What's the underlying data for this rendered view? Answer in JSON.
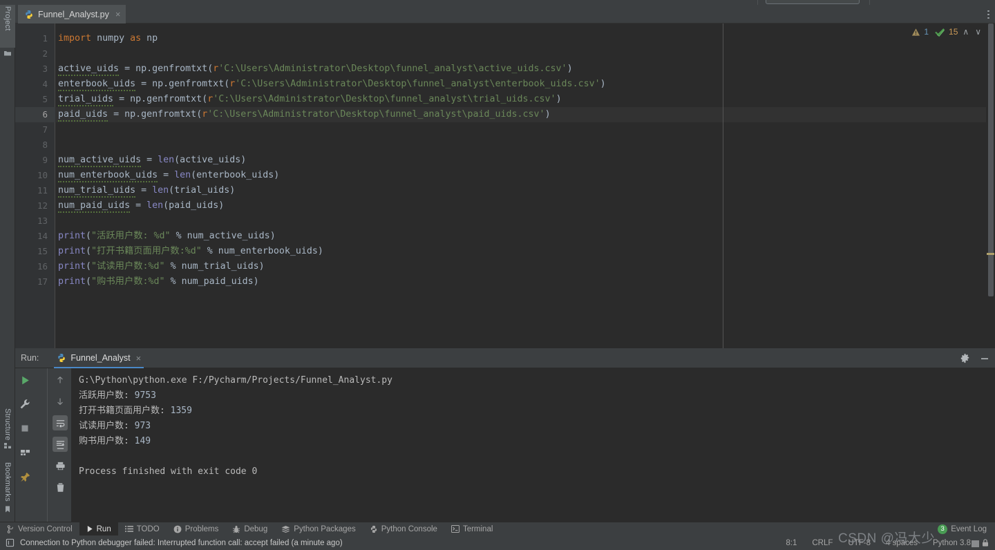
{
  "window": {
    "left_tool_tabs": [
      {
        "label": "Project",
        "icon": "folder-icon",
        "selected": true
      },
      {
        "label": "Structure",
        "icon": "structure-icon",
        "selected": false
      },
      {
        "label": "Bookmarks",
        "icon": "bookmark-icon",
        "selected": false
      }
    ]
  },
  "editor_tabs": [
    {
      "label": "Funnel_Analyst.py",
      "icon": "python-file-icon",
      "close": "×",
      "active": true
    }
  ],
  "inspection_widget": {
    "warning_icon": "warning-triangle-icon",
    "warning_count": "1",
    "typo_icon": "green-check-icon",
    "typo_count": "15",
    "prev_label": "∧",
    "next_label": "∨"
  },
  "editor": {
    "line_numbers": [
      "1",
      "2",
      "3",
      "4",
      "5",
      "6",
      "7",
      "8",
      "9",
      "10",
      "11",
      "12",
      "13",
      "14",
      "15",
      "16",
      "17"
    ],
    "caret_line": 6,
    "lines": [
      {
        "n": 1,
        "tokens": [
          {
            "t": "import",
            "c": "kw"
          },
          {
            "t": " ",
            "c": "id"
          },
          {
            "t": "numpy",
            "c": "id"
          },
          {
            "t": " ",
            "c": "id"
          },
          {
            "t": "as",
            "c": "kw"
          },
          {
            "t": " ",
            "c": "id"
          },
          {
            "t": "np",
            "c": "id"
          }
        ]
      },
      {
        "n": 2,
        "tokens": []
      },
      {
        "n": 3,
        "tokens": [
          {
            "t": "active_uids",
            "c": "id typo"
          },
          {
            "t": " = ",
            "c": "punc"
          },
          {
            "t": "np",
            "c": "id"
          },
          {
            "t": ".",
            "c": "punc"
          },
          {
            "t": "genfromtxt",
            "c": "id"
          },
          {
            "t": "(",
            "c": "punc"
          },
          {
            "t": "r",
            "c": "pfx"
          },
          {
            "t": "'C:\\Users\\Administrator\\Desktop\\funnel_analyst\\active_uids.csv'",
            "c": "str"
          },
          {
            "t": ")",
            "c": "punc"
          }
        ]
      },
      {
        "n": 4,
        "tokens": [
          {
            "t": "enterbook_uids",
            "c": "id typo"
          },
          {
            "t": " = ",
            "c": "punc"
          },
          {
            "t": "np",
            "c": "id"
          },
          {
            "t": ".",
            "c": "punc"
          },
          {
            "t": "genfromtxt",
            "c": "id"
          },
          {
            "t": "(",
            "c": "punc"
          },
          {
            "t": "r",
            "c": "pfx"
          },
          {
            "t": "'C:\\Users\\Administrator\\Desktop\\funnel_analyst\\enterbook_uids.csv'",
            "c": "str"
          },
          {
            "t": ")",
            "c": "punc"
          }
        ]
      },
      {
        "n": 5,
        "tokens": [
          {
            "t": "trial_uids",
            "c": "id typo"
          },
          {
            "t": " = ",
            "c": "punc"
          },
          {
            "t": "np",
            "c": "id"
          },
          {
            "t": ".",
            "c": "punc"
          },
          {
            "t": "genfromtxt",
            "c": "id"
          },
          {
            "t": "(",
            "c": "punc"
          },
          {
            "t": "r",
            "c": "pfx"
          },
          {
            "t": "'C:\\Users\\Administrator\\Desktop\\funnel_analyst\\trial_uids.csv'",
            "c": "str"
          },
          {
            "t": ")",
            "c": "punc"
          }
        ]
      },
      {
        "n": 6,
        "tokens": [
          {
            "t": "paid_uids",
            "c": "id typo"
          },
          {
            "t": " = ",
            "c": "punc"
          },
          {
            "t": "np",
            "c": "id"
          },
          {
            "t": ".",
            "c": "punc"
          },
          {
            "t": "genfromtxt",
            "c": "id"
          },
          {
            "t": "(",
            "c": "punc"
          },
          {
            "t": "r",
            "c": "pfx"
          },
          {
            "t": "'C:\\Users\\Administrator\\Desktop\\funnel_analyst\\paid_uids.csv'",
            "c": "str"
          },
          {
            "t": ")",
            "c": "punc"
          }
        ]
      },
      {
        "n": 7,
        "tokens": []
      },
      {
        "n": 8,
        "tokens": []
      },
      {
        "n": 9,
        "tokens": [
          {
            "t": "num_active_uids",
            "c": "id typo"
          },
          {
            "t": " = ",
            "c": "punc"
          },
          {
            "t": "len",
            "c": "bi"
          },
          {
            "t": "(active_uids)",
            "c": "punc"
          }
        ]
      },
      {
        "n": 10,
        "tokens": [
          {
            "t": "num_enterbook_uids",
            "c": "id typo"
          },
          {
            "t": " = ",
            "c": "punc"
          },
          {
            "t": "len",
            "c": "bi"
          },
          {
            "t": "(enterbook_uids)",
            "c": "punc"
          }
        ]
      },
      {
        "n": 11,
        "tokens": [
          {
            "t": "num_trial_uids",
            "c": "id typo"
          },
          {
            "t": " = ",
            "c": "punc"
          },
          {
            "t": "len",
            "c": "bi"
          },
          {
            "t": "(trial_uids)",
            "c": "punc"
          }
        ]
      },
      {
        "n": 12,
        "tokens": [
          {
            "t": "num_paid_uids",
            "c": "id typo"
          },
          {
            "t": " = ",
            "c": "punc"
          },
          {
            "t": "len",
            "c": "bi"
          },
          {
            "t": "(paid_uids)",
            "c": "punc"
          }
        ]
      },
      {
        "n": 13,
        "tokens": []
      },
      {
        "n": 14,
        "tokens": [
          {
            "t": "print",
            "c": "bi"
          },
          {
            "t": "(",
            "c": "punc"
          },
          {
            "t": "\"活跃用户数: %d\"",
            "c": "str"
          },
          {
            "t": " % ",
            "c": "punc"
          },
          {
            "t": "num_active_uids)",
            "c": "punc"
          }
        ]
      },
      {
        "n": 15,
        "tokens": [
          {
            "t": "print",
            "c": "bi"
          },
          {
            "t": "(",
            "c": "punc"
          },
          {
            "t": "\"打开书籍页面用户数:%d\"",
            "c": "str"
          },
          {
            "t": " % ",
            "c": "punc"
          },
          {
            "t": "num_enterbook_uids)",
            "c": "punc"
          }
        ]
      },
      {
        "n": 16,
        "tokens": [
          {
            "t": "print",
            "c": "bi"
          },
          {
            "t": "(",
            "c": "punc"
          },
          {
            "t": "\"试读用户数:%d\"",
            "c": "str"
          },
          {
            "t": " % ",
            "c": "punc"
          },
          {
            "t": "num_trial_uids)",
            "c": "punc"
          }
        ]
      },
      {
        "n": 17,
        "tokens": [
          {
            "t": "print",
            "c": "bi"
          },
          {
            "t": "(",
            "c": "punc"
          },
          {
            "t": "\"购书用户数:%d\"",
            "c": "str"
          },
          {
            "t": " % ",
            "c": "punc"
          },
          {
            "t": "num_paid_uids)",
            "c": "punc"
          }
        ]
      }
    ]
  },
  "run_window": {
    "title": "Run:",
    "tab_label": "Funnel_Analyst",
    "tab_icon": "python-file-icon",
    "tab_close": "×",
    "settings_icon": "gear-icon",
    "minimize_icon": "minimize-icon",
    "toolbar_left": [
      {
        "icon": "rerun-play-icon",
        "name": "rerun-button"
      },
      {
        "icon": "wrench-icon",
        "name": "modify-run-configuration-button"
      },
      {
        "icon": "stop-square-icon",
        "name": "stop-button"
      },
      {
        "icon": "layout-icon",
        "name": "restore-layout-button"
      },
      {
        "icon": "pin-icon",
        "name": "pin-tab-button"
      }
    ],
    "toolbar_right": [
      {
        "icon": "arrow-up-icon",
        "name": "up-the-stack-trace-button"
      },
      {
        "icon": "arrow-down-icon",
        "name": "down-the-stack-trace-button"
      },
      {
        "icon": "soft-wrap-icon",
        "name": "soft-wrap-button",
        "active": true
      },
      {
        "icon": "scroll-to-end-icon",
        "name": "scroll-to-end-button",
        "active": true
      },
      {
        "icon": "printer-icon",
        "name": "print-button"
      },
      {
        "icon": "trash-icon",
        "name": "clear-all-button"
      }
    ],
    "console_lines": [
      "G:\\Python\\python.exe F:/Pycharm/Projects/Funnel_Analyst.py",
      "活跃用户数: 9753",
      "打开书籍页面用户数: 1359",
      "试读用户数: 973",
      "购书用户数: 149",
      "",
      "Process finished with exit code 0"
    ]
  },
  "bottom_tabs": [
    {
      "label": "Version Control",
      "icon": "branch-icon",
      "selected": false
    },
    {
      "label": "Run",
      "icon": "play-icon",
      "selected": true
    },
    {
      "label": "TODO",
      "icon": "todo-list-icon",
      "selected": false
    },
    {
      "label": "Problems",
      "icon": "problems-info-icon",
      "selected": false
    },
    {
      "label": "Debug",
      "icon": "bug-icon",
      "selected": false
    },
    {
      "label": "Python Packages",
      "icon": "packages-icon",
      "selected": false
    },
    {
      "label": "Python Console",
      "icon": "python-console-icon",
      "selected": false
    },
    {
      "label": "Terminal",
      "icon": "terminal-icon",
      "selected": false
    }
  ],
  "event_log": {
    "label": "Event Log",
    "badge": "3"
  },
  "status_bar": {
    "message_icon": "notification-icon",
    "message": "Connection to Python debugger failed: Interrupted function call: accept failed (a minute ago)",
    "caret_position": "8:1",
    "line_separator": "CRLF",
    "encoding": "UTF-8",
    "indent": "4 spaces",
    "interpreter": "Python 3.8",
    "lock_icon": "lock-icon"
  },
  "watermark": {
    "text": "CSDN @冯大少"
  },
  "colors": {
    "accent_blue": "#4a88c7",
    "keyword_orange": "#cc7832",
    "string_green": "#6a8759",
    "number_blue": "#6897bb",
    "builtin_purple": "#8888c6",
    "editor_bg": "#2b2b2b",
    "chrome_bg": "#3c3f41",
    "badge_green": "#499c54"
  }
}
